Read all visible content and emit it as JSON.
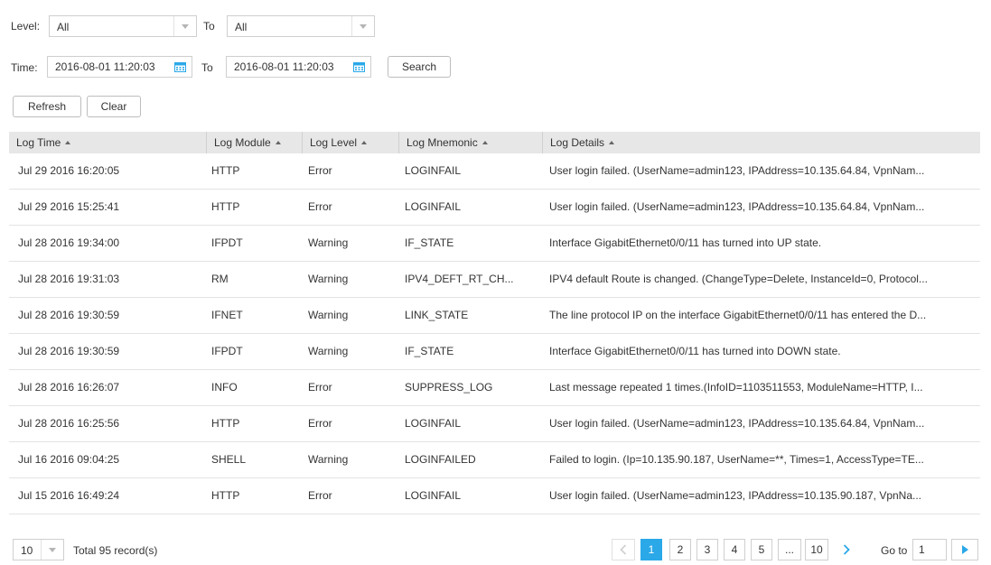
{
  "filters": {
    "level_label": "Level:",
    "level_from": "All",
    "to_label": "To",
    "level_to": "All",
    "time_label": "Time:",
    "time_from": "2016-08-01 11:20:03",
    "time_to_label": "To",
    "time_to": "2016-08-01 11:20:03",
    "search_label": "Search"
  },
  "actions": {
    "refresh_label": "Refresh",
    "clear_label": "Clear"
  },
  "table": {
    "headers": [
      "Log Time",
      "Log Module",
      "Log Level",
      "Log Mnemonic",
      "Log Details"
    ],
    "rows": [
      [
        "Jul 29 2016 16:20:05",
        "HTTP",
        "Error",
        "LOGINFAIL",
        "User login failed. (UserName=admin123, IPAddress=10.135.64.84, VpnNam..."
      ],
      [
        "Jul 29 2016 15:25:41",
        "HTTP",
        "Error",
        "LOGINFAIL",
        "User login failed. (UserName=admin123, IPAddress=10.135.64.84, VpnNam..."
      ],
      [
        "Jul 28 2016 19:34:00",
        "IFPDT",
        "Warning",
        "IF_STATE",
        "Interface GigabitEthernet0/0/11 has turned into UP state."
      ],
      [
        "Jul 28 2016 19:31:03",
        "RM",
        "Warning",
        "IPV4_DEFT_RT_CH...",
        "IPV4 default Route is changed. (ChangeType=Delete, InstanceId=0, Protocol..."
      ],
      [
        "Jul 28 2016 19:30:59",
        "IFNET",
        "Warning",
        "LINK_STATE",
        "The line protocol IP on the interface GigabitEthernet0/0/11 has entered the D..."
      ],
      [
        "Jul 28 2016 19:30:59",
        "IFPDT",
        "Warning",
        "IF_STATE",
        "Interface GigabitEthernet0/0/11 has turned into DOWN state."
      ],
      [
        "Jul 28 2016 16:26:07",
        "INFO",
        "Error",
        "SUPPRESS_LOG",
        "Last message repeated 1 times.(InfoID=1103511553, ModuleName=HTTP, I..."
      ],
      [
        "Jul 28 2016 16:25:56",
        "HTTP",
        "Error",
        "LOGINFAIL",
        "User login failed. (UserName=admin123, IPAddress=10.135.64.84, VpnNam..."
      ],
      [
        "Jul 16 2016 09:04:25",
        "SHELL",
        "Warning",
        "LOGINFAILED",
        "Failed to login. (Ip=10.135.90.187, UserName=**, Times=1, AccessType=TE..."
      ],
      [
        "Jul 15 2016 16:49:24",
        "HTTP",
        "Error",
        "LOGINFAIL",
        "User login failed. (UserName=admin123, IPAddress=10.135.90.187, VpnNa..."
      ]
    ]
  },
  "footer": {
    "page_size": "10",
    "total": "Total 95 record(s)",
    "pages": [
      "1",
      "2",
      "3",
      "4",
      "5",
      "...",
      "10"
    ],
    "current_page": "1",
    "goto_label": "Go to",
    "goto_value": "1"
  },
  "colors": {
    "accent": "#2aa8e8",
    "header_bg": "#e7e7e7",
    "calendar": "#2aa8e8"
  }
}
